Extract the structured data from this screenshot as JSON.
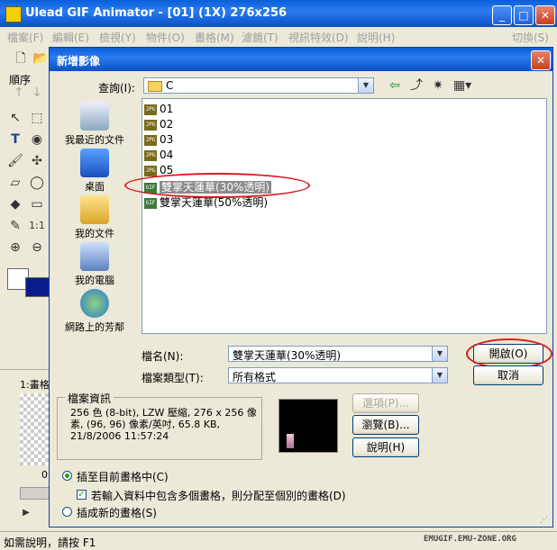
{
  "app": {
    "title": "Ulead GIF Animator - [01] (1X) 276x256",
    "menu": [
      "檔案(F)",
      "編輯(E)",
      "檢視(Y)",
      "物件(O)",
      "畫格(M)",
      "濾鏡(T)",
      "視訊特效(D)",
      "說明(H)"
    ],
    "menu_right": "切換(S)",
    "sequence_label": "順序",
    "frame_panel_label": "1:畫格",
    "frame_panel_num": "0"
  },
  "dialog": {
    "title": "新增影像",
    "look_in_label": "查詢(I):",
    "look_in_value": "C",
    "places": [
      {
        "label": "我最近的文件",
        "icon": "recent-documents-icon"
      },
      {
        "label": "桌面",
        "icon": "desktop-icon"
      },
      {
        "label": "我的文件",
        "icon": "my-documents-icon"
      },
      {
        "label": "我的電腦",
        "icon": "my-computer-icon"
      },
      {
        "label": "網路上的芳鄰",
        "icon": "network-places-icon"
      }
    ],
    "files": [
      {
        "name": "01",
        "type": "JPG"
      },
      {
        "name": "02",
        "type": "JPG"
      },
      {
        "name": "03",
        "type": "JPG"
      },
      {
        "name": "04",
        "type": "JPG"
      },
      {
        "name": "05",
        "type": "JPG"
      },
      {
        "name": "雙掌天蓮華(30%透明)",
        "type": "GIF",
        "selected": true
      },
      {
        "name": "雙掌天蓮華(50%透明)",
        "type": "GIF"
      }
    ],
    "filename_label": "檔名(N):",
    "filename_value": "雙掌天蓮華(30%透明)",
    "filetype_label": "檔案類型(T):",
    "filetype_value": "所有格式",
    "open_button": "開啟(O)",
    "cancel_button": "取消",
    "info_header": "檔案資訊",
    "info_text": "256 色 (8-bit), LZW 壓縮, 276 x 256 像素, (96, 96) 像素/英吋, 65.8 KB, 21/8/2006  11:57:24",
    "options_button": "選項(P)...",
    "browse_button": "瀏覽(B)...",
    "help_button": "說明(H)",
    "radio_insert": "插至目前畫格中(C)",
    "checkbox_distribute": "若輸入資料中包含多個畫格，則分配至個別的畫格(D)",
    "radio_new": "插成新的畫格(S)"
  },
  "status": {
    "text": "如需說明，請按 F1",
    "watermark": "EMUGIF.EMU-ZONE.ORG"
  },
  "colors": {
    "highlight": "#d81c1c",
    "titlebar": "#0a5fd8"
  }
}
